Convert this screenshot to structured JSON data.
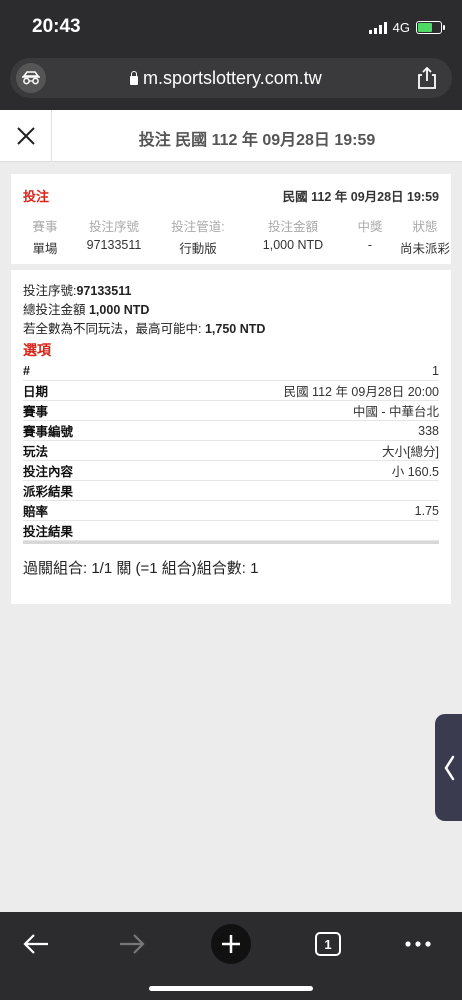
{
  "status_bar": {
    "time": "20:43",
    "network": "4G"
  },
  "browser": {
    "url": "m.sportslottery.com.tw",
    "open_tabs": "1"
  },
  "header": {
    "title": "投注 民國 112 年 09月28日 19:59"
  },
  "summary": {
    "bet_label": "投注",
    "date": "民國 112 年 09月28日 19:59",
    "columns": [
      {
        "header": "賽事",
        "value": "單場"
      },
      {
        "header": "投注序號",
        "value": "97133511"
      },
      {
        "header": "投注管道:",
        "value": "行動版"
      },
      {
        "header": "投注金額",
        "value": "1,000 NTD"
      },
      {
        "header": "中獎",
        "value": "-"
      },
      {
        "header": "狀態",
        "value": "尚未派彩"
      }
    ]
  },
  "detail": {
    "serial_label": "投注序號:",
    "serial_value": "97133511",
    "total_label": "總投注金額 ",
    "total_value": "1,000 NTD",
    "max_win_label": "若全數為不同玩法，最高可能中: ",
    "max_win_value": "1,750 NTD",
    "options_title": "選項",
    "rows": [
      {
        "key": "#",
        "value": "1"
      },
      {
        "key": "日期",
        "value": "民國 112 年 09月28日 20:00"
      },
      {
        "key": "賽事",
        "value": "中國 - 中華台北"
      },
      {
        "key": "賽事編號",
        "value": "338"
      },
      {
        "key": "玩法",
        "value": "大小[總分]"
      },
      {
        "key": "投注內容",
        "value": "小 160.5"
      },
      {
        "key": "派彩結果",
        "value": ""
      },
      {
        "key": "賠率",
        "value": "1.75"
      },
      {
        "key": "投注結果",
        "value": ""
      }
    ],
    "combo_text": "過關組合: 1/1 關 (=1 組合)組合數: 1"
  },
  "icons": {
    "incognito": "incognito-icon",
    "share": "share-icon",
    "close": "close-icon",
    "side_tab": "chevron-left-icon",
    "back": "arrow-left-icon",
    "forward": "arrow-right-icon",
    "new_tab": "plus-icon",
    "tabs": "tabs-icon",
    "more": "more-icon"
  },
  "colors": {
    "accent_red": "#d9261c",
    "browser_chrome": "#2c2c2e",
    "battery_green": "#4cd964"
  }
}
